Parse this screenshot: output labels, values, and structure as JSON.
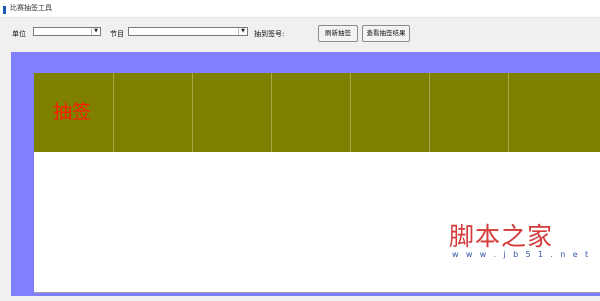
{
  "window": {
    "title": "比赛抽签工具"
  },
  "toolbar": {
    "unit_label": "单位",
    "unit_select": {
      "value": ""
    },
    "program_label": "节目",
    "program_select": {
      "value": ""
    },
    "drawn_label": "抽到签号:",
    "drawn_value": "",
    "refresh_button": "刷新抽签",
    "view_results_button": "查看抽签结果"
  },
  "board": {
    "draw_label": "抽签",
    "slot_count": 7
  },
  "watermark": {
    "text": "脚本之家",
    "url": "w w w . j b 5 1 . n e t"
  },
  "colors": {
    "workspace": "#8080ff",
    "strip": "#808000",
    "draw_text": "#ff1a00",
    "watermark": "#d43a3a"
  }
}
